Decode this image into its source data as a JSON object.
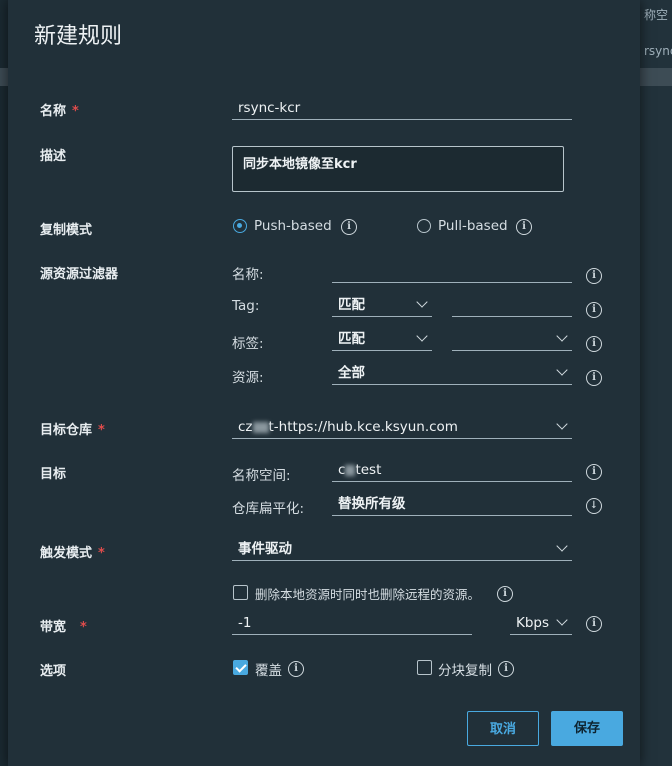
{
  "background": {
    "col_header": "称空",
    "row_text": "rsync"
  },
  "dialog": {
    "title": "新建规则",
    "fields": {
      "name": {
        "label": "名称",
        "value": "rsync-kcr"
      },
      "description": {
        "label": "描述",
        "value": "同步本地镜像至kcr"
      },
      "replication_mode": {
        "label": "复制模式",
        "options": [
          "Push-based",
          "Pull-based"
        ],
        "selected": "Push-based"
      },
      "source_filter": {
        "label": "源资源过滤器",
        "name_label": "名称:",
        "tag_label": "Tag:",
        "tag_match": "匹配",
        "label_label": "标签:",
        "label_match": "匹配",
        "resource_label": "资源:",
        "resource_value": "全部"
      },
      "target_registry": {
        "label": "目标仓库",
        "value_prefix": "cz",
        "value_suffix": "t-https://hub.kce.ksyun.com"
      },
      "target": {
        "label": "目标",
        "namespace_label": "名称空间:",
        "namespace_prefix": "c",
        "namespace_suffix": "test",
        "flatten_label": "仓库扁平化:",
        "flatten_value": "替换所有级"
      },
      "trigger_mode": {
        "label": "触发模式",
        "value": "事件驱动"
      },
      "delete_remote": {
        "label": "删除本地资源时同时也删除远程的资源。",
        "checked": false
      },
      "bandwidth": {
        "label": "带宽",
        "value": "-1",
        "unit": "Kbps"
      },
      "options": {
        "label": "选项",
        "override": "覆盖",
        "override_checked": true,
        "chunked": "分块复制",
        "chunked_checked": false
      }
    },
    "buttons": {
      "cancel": "取消",
      "save": "保存"
    }
  },
  "colors": {
    "accent": "#49a9e0",
    "required": "#e04c4c",
    "dialog_bg": "#213039"
  }
}
